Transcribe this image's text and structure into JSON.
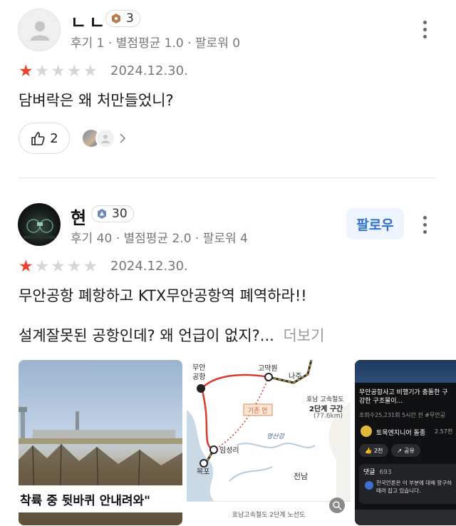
{
  "review1": {
    "username": "ㄴㄴ",
    "level": "3",
    "stats": "후기 1 · 별점평균 1.0 · 팔로워 0",
    "rating": 1,
    "date": "2024.12.30.",
    "text": "담벼락은 왜 처만들었니?",
    "like_count": "2"
  },
  "review2": {
    "username": "현",
    "level": "30",
    "stats": "후기 40 · 별점평균 2.0 · 팔로워 4",
    "follow_label": "팔로우",
    "rating": 1,
    "date": "2024.12.30.",
    "text_line1": "무안공항 폐항하고 KTX무안공항역 폐역하라!!",
    "text_line2": "설계잘못된 공항인데? 왜 언급이 없지?...",
    "more_label": "더보기",
    "photo1_caption": "착륙 중 뒷바퀴 안내려와\"",
    "map": {
      "label_muan_airport_1": "무안",
      "label_muan_airport_2": "공항",
      "label_gomakwon": "고막원",
      "label_naju": "나주",
      "label_phase": "호남 고속철도",
      "label_phase2": "2단계 구간",
      "label_distance": "(77.6km)",
      "label_existing": "기존 안",
      "label_river": "영산강",
      "label_imseongri": "임성리",
      "label_mokpo": "목포",
      "label_jeonnam": "전남",
      "caption": "호남고속철도 2단계 노선도"
    },
    "video": {
      "title_1": "무안공항사고 비행기가 충돌한 구",
      "title_2": "강한 구조물이...",
      "meta": "조회수25,231회  5시간 전  #무안공",
      "channel": "토목엔지니어 돌종",
      "subs": "2.57천",
      "likes": "2천",
      "share": "공유",
      "comments_label": "댓글",
      "comments_count": "693",
      "comment_1": "한국언론은 이 부분에 대해 항구하",
      "comment_2": "때려 잡고 있습니다."
    }
  },
  "colors": {
    "star_active": "#e8452c",
    "star_inactive": "#d6d6d6",
    "follow_text": "#2f6fd6",
    "follow_bg": "#eef4fd"
  }
}
